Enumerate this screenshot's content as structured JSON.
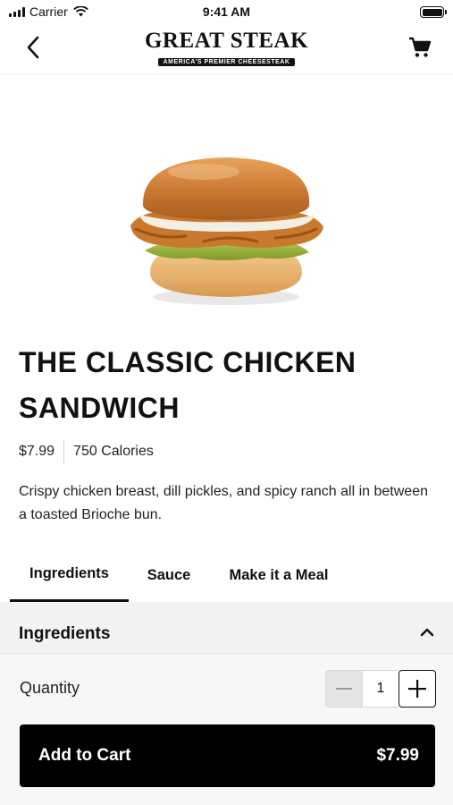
{
  "status_bar": {
    "carrier": "Carrier",
    "time": "9:41 AM"
  },
  "header": {
    "logo_title": "GREAT STEAK",
    "logo_subtitle": "AMERICA'S PREMIER CHEESESTEAK",
    "back_icon": "chevron-left-icon",
    "cart_icon": "shopping-cart-icon"
  },
  "product": {
    "title": "THE CLASSIC CHICKEN SANDWICH",
    "price": "$7.99",
    "calories": "750 Calories",
    "description": "Crispy chicken breast, dill pickles, and spicy ranch all in between a toasted Brioche bun."
  },
  "tabs": [
    {
      "label": "Ingredients",
      "active": true
    },
    {
      "label": "Sauce",
      "active": false
    },
    {
      "label": "Make it a Meal",
      "active": false
    }
  ],
  "accordion": {
    "title": "Ingredients",
    "icon": "chevron-up-icon"
  },
  "order": {
    "quantity_label": "Quantity",
    "quantity": "1",
    "add_label": "Add to Cart",
    "add_price": "$7.99"
  },
  "colors": {
    "primary": "#000000",
    "panel_bg": "#f3f3f3",
    "text": "#111111"
  }
}
